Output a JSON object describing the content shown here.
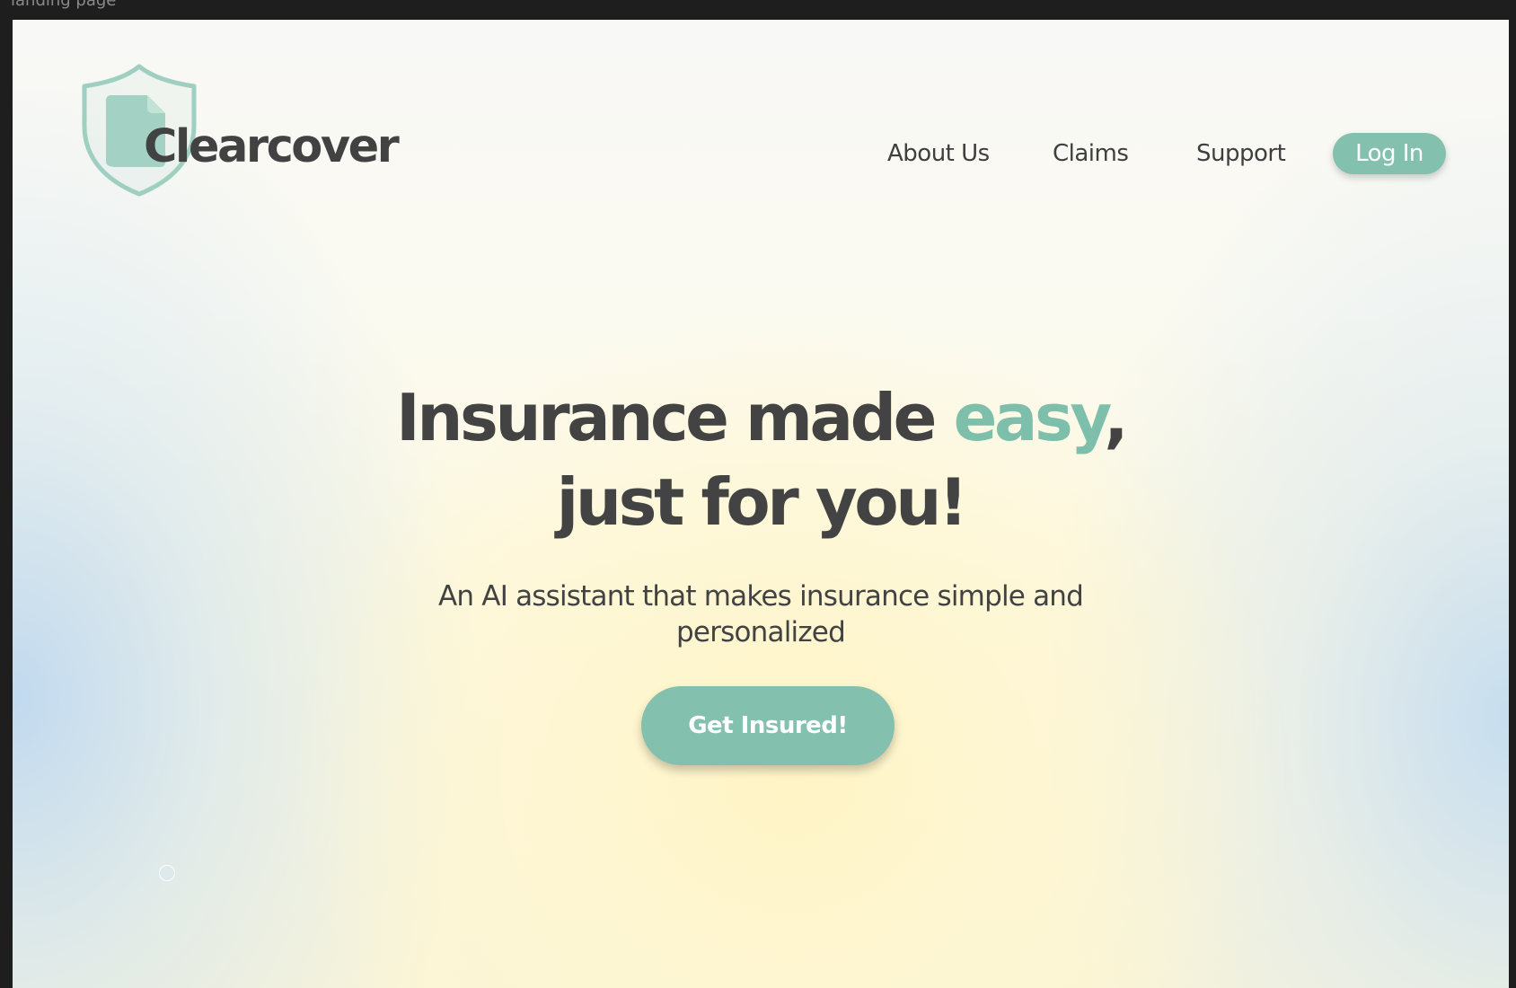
{
  "window": {
    "title": "landing page"
  },
  "brand": {
    "name": "Clearcover",
    "icon": "shield-document-icon",
    "accent_color": "#84c0ae",
    "text_color": "#424242"
  },
  "nav": {
    "items": [
      {
        "label": "About Us"
      },
      {
        "label": "Claims"
      },
      {
        "label": "Support"
      }
    ],
    "login_label": "Log In"
  },
  "hero": {
    "headline_part1": "Insurance made ",
    "headline_accent": "easy",
    "headline_part2": ",",
    "headline_line2": "just for you!",
    "subheadline": "An AI assistant that makes insurance simple and personalized",
    "cta_label": "Get Insured!"
  }
}
